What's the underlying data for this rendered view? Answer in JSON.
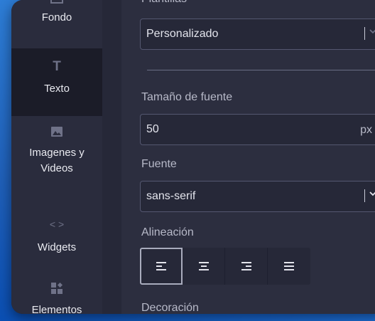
{
  "sidebar": {
    "items": [
      {
        "label": "Fondo",
        "icon": "image-icon"
      },
      {
        "label": "Texto",
        "icon": "text-icon",
        "active": true
      },
      {
        "label": "Imagenes y Videos",
        "label_line1": "Imagenes y",
        "label_line2": "Videos",
        "icon": "photo-icon"
      },
      {
        "label": "Widgets",
        "icon": "code-icon"
      },
      {
        "label": "Elementos",
        "icon": "elements-icon"
      }
    ]
  },
  "content": {
    "plantillas_label": "Plantillas",
    "plantilla_value": "Personalizado",
    "font_size_label": "Tamaño de fuente",
    "font_size_value": "50",
    "font_size_unit": "px",
    "font_label": "Fuente",
    "font_value": "sans-serif",
    "align_label": "Alineación",
    "align_options": [
      "left",
      "center",
      "right",
      "justify"
    ],
    "align_selected": "left",
    "decoration_label": "Decoración"
  },
  "colors": {
    "panel_bg": "#2c2e3f",
    "sidebar_bg": "#2a2c3d",
    "field_bg": "#262838",
    "field_border": "#545770",
    "desktop_bg": "#1f5fb8"
  }
}
